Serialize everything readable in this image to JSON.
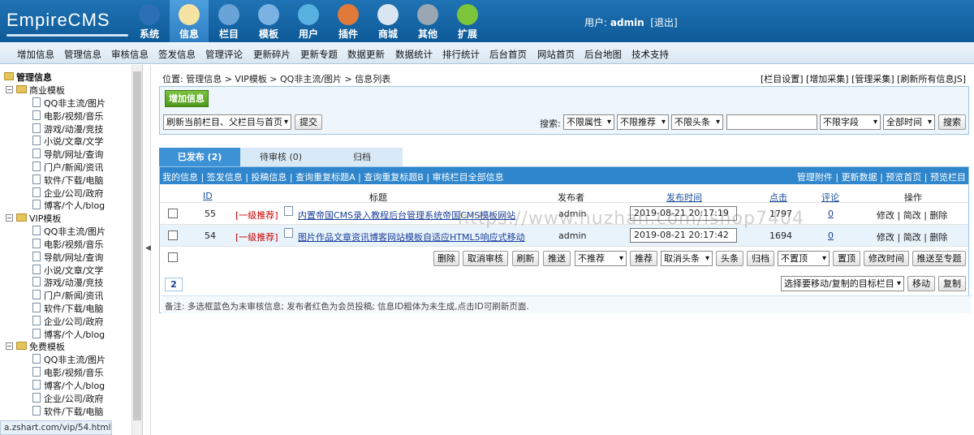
{
  "logo": {
    "text": "EmpireCMS"
  },
  "topnav": [
    {
      "label": "系统",
      "icon": "globe-icon",
      "color": "#2d6fb5"
    },
    {
      "label": "信息",
      "icon": "notepad-icon",
      "color": "#f4e3a3",
      "active": true
    },
    {
      "label": "栏目",
      "icon": "folder-icon",
      "color": "#6aa3d8"
    },
    {
      "label": "模板",
      "icon": "window-icon",
      "color": "#7ab3e3"
    },
    {
      "label": "用户",
      "icon": "user-icon",
      "color": "#56b0e0"
    },
    {
      "label": "插件",
      "icon": "tools-icon",
      "color": "#e07a3a"
    },
    {
      "label": "商城",
      "icon": "card-icon",
      "color": "#d9e6f2"
    },
    {
      "label": "其他",
      "icon": "gear-icon",
      "color": "#9aa7b3"
    },
    {
      "label": "扩展",
      "icon": "plus-icon",
      "color": "#7cc43a"
    }
  ],
  "userinfo": {
    "prefix": "用户:",
    "user": "admin",
    "logout": "[退出]"
  },
  "subnav": [
    "增加信息",
    "管理信息",
    "审核信息",
    "签发信息",
    "管理评论",
    "更新碎片",
    "更新专题",
    "数据更新",
    "数据统计",
    "排行统计",
    "后台首页",
    "网站首页",
    "后台地图",
    "技术支持"
  ],
  "tree": {
    "title": "管理信息",
    "groups": [
      {
        "label": "商业模板",
        "items": [
          "QQ非主流/图片",
          "电影/视频/音乐",
          "游戏/动漫/竞技",
          "小说/文章/文学",
          "导航/网址/查询",
          "门户/新闻/资讯",
          "软件/下载/电脑",
          "企业/公司/政府",
          "博客/个人/blog"
        ]
      },
      {
        "label": "VIP模板",
        "items": [
          "QQ非主流/图片",
          "电影/视频/音乐",
          "导航/网址/查询",
          "小说/文章/文学",
          "游戏/动漫/竞技",
          "门户/新闻/资讯",
          "软件/下载/电脑",
          "企业/公司/政府",
          "博客/个人/blog"
        ]
      },
      {
        "label": "免费模板",
        "items": [
          "QQ非主流/图片",
          "电影/视频/音乐",
          "博客/个人/blog",
          "企业/公司/政府",
          "软件/下载/电脑"
        ]
      }
    ]
  },
  "status_url": "a.zshart.com/vip/54.html",
  "breadcrumb": "位置: 管理信息 > VIP模板 > QQ非主流/图片 > 信息列表",
  "crumb_links": "[栏目设置] [增加采集] [管理采集] [刷新所有信息JS]",
  "toolbar": {
    "add_label": "增加信息",
    "refresh_select": "刷新当前栏目、父栏目与首页",
    "submit_label": "提交",
    "search_label": "搜索:",
    "search_value": "",
    "filters": [
      "不限属性",
      "不限推荐",
      "不限头条"
    ],
    "field_select": "不限字段",
    "time_select": "全部时间",
    "search_button": "搜索"
  },
  "tabs": [
    "已发布 (2)",
    "待审核 (0)",
    "归档"
  ],
  "list_links_left": "我的信息 | 签发信息 | 投稿信息 | 查询重复标题A | 查询重复标题B | 审核栏目全部信息",
  "list_links_right": "管理附件 | 更新数据 | 预览首页 | 预览栏目",
  "columns": [
    "ID",
    "标题",
    "发布者",
    "发布时间",
    "点击",
    "评论",
    "操作"
  ],
  "rows": [
    {
      "id": "55",
      "tag": "[一级推荐]",
      "title": "内置帝国CMS录入教程后台管理系统帝国CMS模板网站",
      "author": "admin",
      "time": "2019-08-21 20:17:19",
      "hits": "1797",
      "comments": "0",
      "actions": "修改 | 简改 | 删除"
    },
    {
      "id": "54",
      "tag": "[一级推荐]",
      "title": "图片作品文章资讯博客网站模板自适应HTML5响应式移动",
      "author": "admin",
      "time": "2019-08-21 20:17:42",
      "hits": "1694",
      "comments": "0",
      "actions": "修改 | 简改 | 删除"
    }
  ],
  "bulk": {
    "delete": "删除",
    "unapprove": "取消审核",
    "refresh": "刷新",
    "push": "推送",
    "norecommend": "不推荐",
    "recommend": "推荐",
    "cancel_headline": "取消头条",
    "headline": "头条",
    "archive": "归档",
    "notop": "不置顶",
    "top": "置顶",
    "edit_time": "修改时间",
    "push_topic": "推送至专题"
  },
  "page": "2",
  "move": {
    "select": "选择要移动/复制的目标栏目",
    "move": "移动",
    "copy": "复制"
  },
  "note": "备注: 多选框蓝色为未审核信息; 发布者红色为会员投稿; 信息ID粗体为未生成,点击ID可刷新页面.",
  "watermark": "https://www.huzhan.com/ishop7404"
}
